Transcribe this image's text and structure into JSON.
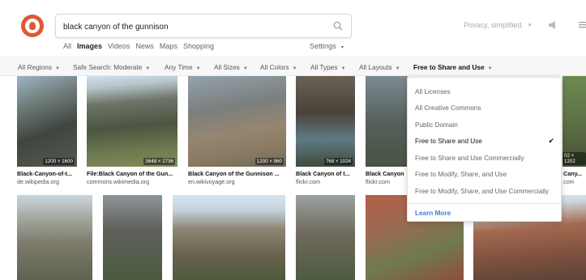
{
  "search": {
    "query": "black canyon of the gunnison"
  },
  "nav": {
    "tabs": [
      "All",
      "Images",
      "Videos",
      "News",
      "Maps",
      "Shopping"
    ],
    "active": "Images",
    "settings": "Settings"
  },
  "header": {
    "privacy": "Privacy, simplified."
  },
  "filters": [
    {
      "label": "All Regions"
    },
    {
      "label": "Safe Search: Moderate"
    },
    {
      "label": "Any Time"
    },
    {
      "label": "All Sizes"
    },
    {
      "label": "All Colors"
    },
    {
      "label": "All Types"
    },
    {
      "label": "All Layouts"
    },
    {
      "label": "Free to Share and Use"
    }
  ],
  "results_row1": [
    {
      "title": "Black-Canyon-of-t...",
      "source": "de.wikipedia.org",
      "dims": "1200 × 1600"
    },
    {
      "title": "File:Black Canyon of the Gun...",
      "source": "commons.wikimedia.org",
      "dims": "3648 × 2736"
    },
    {
      "title": "Black Canyon of the Gunnison ...",
      "source": "en.wikivoyage.org",
      "dims": "1200 × 960"
    },
    {
      "title": "Black Canyon of t...",
      "source": "flickr.com",
      "dims": "768 × 1024"
    },
    {
      "title": "Black Canyon",
      "source": "flickr.com",
      "dims": ""
    },
    {
      "title": "Cany...",
      "source": "com",
      "dims": "02 × 1202"
    }
  ],
  "license_menu": {
    "items": [
      "All Licenses",
      "All Creative Commons",
      "Public Domain",
      "Free to Share and Use",
      "Free to Share and Use Commercially",
      "Free to Modify, Share, and Use",
      "Free to Modify, Share, and Use Commercially"
    ],
    "selected_index": 3,
    "learn_more": "Learn More"
  },
  "colors": {
    "accent": "#de5833",
    "link": "#3b7fd6"
  }
}
